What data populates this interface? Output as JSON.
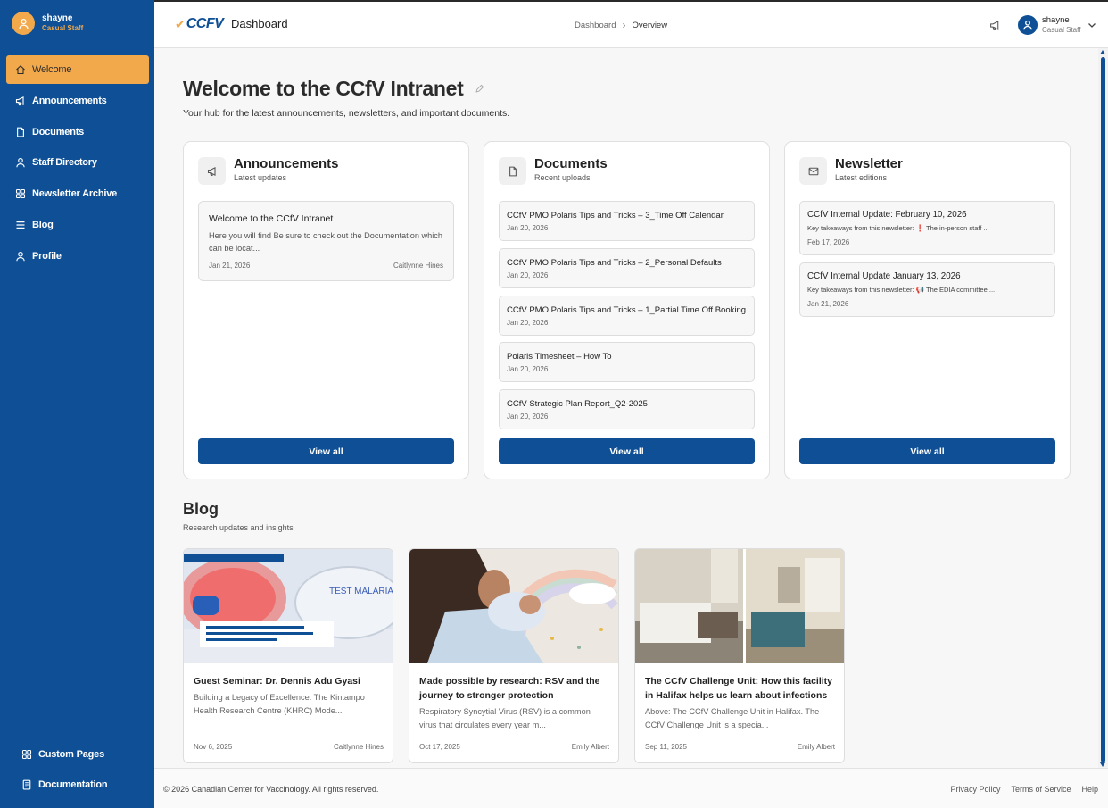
{
  "user": {
    "name": "shayne",
    "role": "Casual Staff",
    "icon": "user-icon"
  },
  "sidebar": {
    "items": [
      {
        "label": "Welcome",
        "icon": "home-icon",
        "active": true
      },
      {
        "label": "Announcements",
        "icon": "megaphone-icon"
      },
      {
        "label": "Documents",
        "icon": "file-icon"
      },
      {
        "label": "Staff Directory",
        "icon": "user-icon"
      },
      {
        "label": "Newsletter Archive",
        "icon": "grid-icon"
      },
      {
        "label": "Blog",
        "icon": "list-icon"
      },
      {
        "label": "Profile",
        "icon": "user-icon"
      }
    ],
    "bottom_items": [
      {
        "label": "Custom Pages",
        "icon": "grid-icon"
      },
      {
        "label": "Documentation",
        "icon": "book-icon"
      }
    ]
  },
  "header": {
    "logo_text": "CCFV",
    "title": "Dashboard",
    "breadcrumb": [
      "Dashboard",
      "Overview"
    ],
    "user_name": "shayne",
    "user_role": "Casual Staff"
  },
  "main": {
    "title": "Welcome to the CCfV Intranet",
    "subtitle": "Your hub for the latest announcements, newsletters, and important documents."
  },
  "cards": {
    "announcements": {
      "title": "Announcements",
      "subtitle": "Latest updates",
      "items": [
        {
          "title": "Welcome to the CCfV Intranet",
          "body": "Here you will find     Be sure to check out the Documentation which can be locat...",
          "date": "Jan 21, 2026",
          "author": "Caitlynne Hines"
        }
      ],
      "button": "View all"
    },
    "documents": {
      "title": "Documents",
      "subtitle": "Recent uploads",
      "items": [
        {
          "title": "CCfV PMO Polaris Tips and Tricks – 3_Time Off Calendar",
          "date": "Jan 20, 2026"
        },
        {
          "title": "CCfV PMO Polaris Tips and Tricks – 2_Personal Defaults",
          "date": "Jan 20, 2026"
        },
        {
          "title": "CCfV PMO Polaris Tips and Tricks – 1_Partial Time Off Booking",
          "date": "Jan 20, 2026"
        },
        {
          "title": "Polaris Timesheet – How To",
          "date": "Jan 20, 2026"
        },
        {
          "title": "CCfV Strategic Plan Report_Q2-2025",
          "date": "Jan 20, 2026"
        }
      ],
      "button": "View all"
    },
    "newsletter": {
      "title": "Newsletter",
      "subtitle": "Latest editions",
      "items": [
        {
          "title": "CCfV Internal Update: February 10, 2026",
          "body": "Key takeaways from this newsletter:  ❗ The in-person staff ...",
          "date": "Feb 17, 2026"
        },
        {
          "title": "CCfV Internal Update January 13, 2026",
          "body": "Key takeaways from this newsletter:  📢 The EDIA committee ...",
          "date": "Jan 21, 2026"
        }
      ],
      "button": "View all"
    }
  },
  "blog": {
    "title": "Blog",
    "subtitle": "Research updates and insights",
    "posts": [
      {
        "title": "Guest Seminar: Dr. Dennis Adu Gyasi",
        "excerpt": "Building a Legacy of Excellence: The Kintampo Health Research Centre (KHRC) Mode...",
        "date": "Nov 6, 2025",
        "author": "Caitlynne Hines",
        "image_text": "TEST MALARIA 50%"
      },
      {
        "title": "Made possible by research: RSV and the journey to stronger protection",
        "excerpt": "Respiratory Syncytial Virus (RSV) is a common virus that circulates every year m...",
        "date": "Oct 17, 2025",
        "author": "Emily Albert"
      },
      {
        "title": "The CCfV Challenge Unit: How this facility in Halifax helps us learn about infections",
        "excerpt": "Above: The CCfV Challenge Unit in Halifax.   The CCfV Challenge Unit is a specia...",
        "date": "Sep 11, 2025",
        "author": "Emily Albert"
      }
    ]
  },
  "footer": {
    "copyright": "© 2026 Canadian Center for Vaccinology. All rights reserved.",
    "links": [
      "Privacy Policy",
      "Terms of Service",
      "Help"
    ]
  },
  "colors": {
    "primary": "#0e4f95",
    "accent": "#f2a94b",
    "background": "#f7f7f7"
  }
}
